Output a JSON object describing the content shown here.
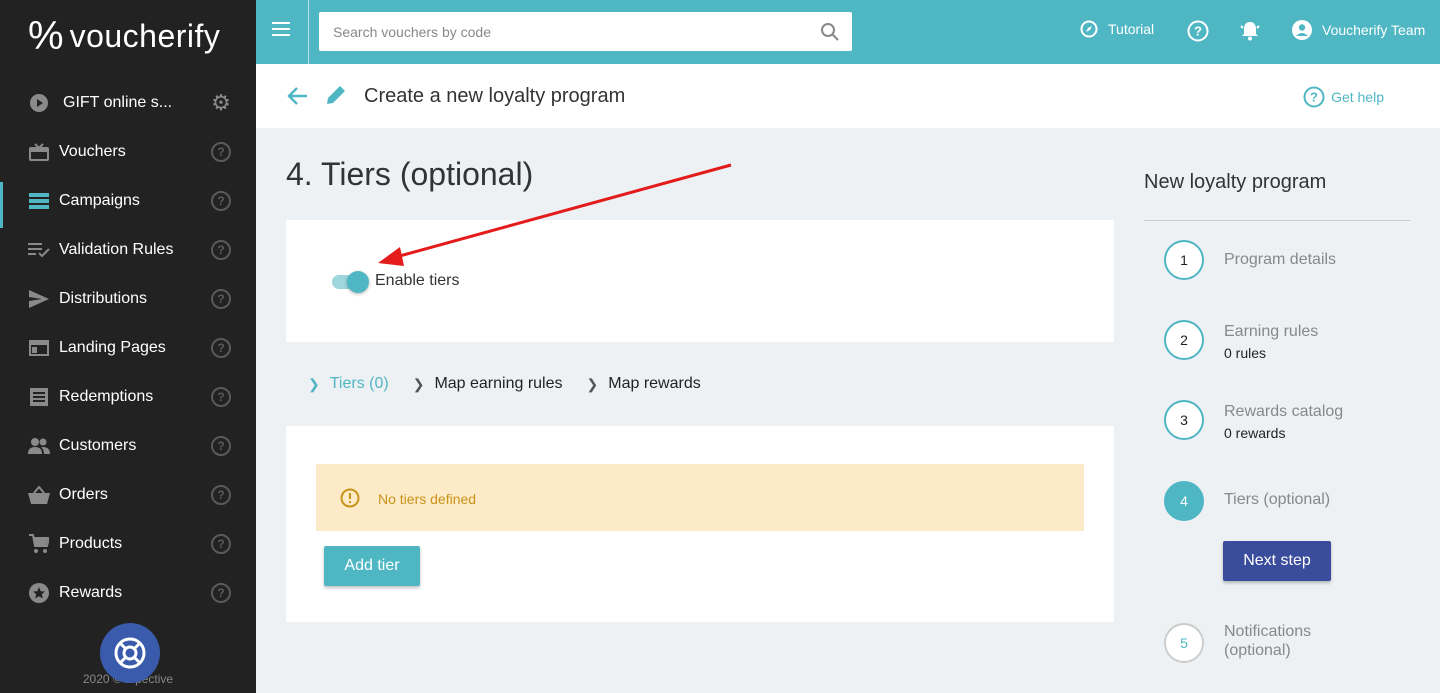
{
  "brand": {
    "logo_mark": "%",
    "logo_text": "voucherify"
  },
  "sidebar": {
    "project": "GIFT online s...",
    "items": [
      {
        "label": "Vouchers",
        "icon": "gift-icon"
      },
      {
        "label": "Campaigns",
        "icon": "campaigns-icon",
        "active": true
      },
      {
        "label": "Validation Rules",
        "icon": "validation-rules-icon"
      },
      {
        "label": "Distributions",
        "icon": "send-icon"
      },
      {
        "label": "Landing Pages",
        "icon": "landing-page-icon"
      },
      {
        "label": "Redemptions",
        "icon": "redemptions-icon"
      },
      {
        "label": "Customers",
        "icon": "customers-icon"
      },
      {
        "label": "Orders",
        "icon": "basket-icon"
      },
      {
        "label": "Products",
        "icon": "cart-icon"
      },
      {
        "label": "Rewards",
        "icon": "star-icon"
      }
    ],
    "help_glyph": "?",
    "copyright": "2020 © rspective"
  },
  "topbar": {
    "search_placeholder": "Search vouchers by code",
    "tutorial": "Tutorial",
    "user": "Voucherify Team"
  },
  "header": {
    "title": "Create a new loyalty program",
    "get_help": "Get help"
  },
  "main": {
    "section_title": "4. Tiers (optional)",
    "toggle_label": "Enable tiers",
    "toggle_on": true,
    "tabs": [
      {
        "label": "Tiers (0)",
        "active": true
      },
      {
        "label": "Map earning rules"
      },
      {
        "label": "Map rewards"
      }
    ],
    "alert_text": "No tiers defined",
    "add_button": "Add tier"
  },
  "right_panel": {
    "title": "New loyalty program",
    "steps": [
      {
        "num": "1",
        "label": "Program details",
        "sub": ""
      },
      {
        "num": "2",
        "label": "Earning rules",
        "sub": "0 rules"
      },
      {
        "num": "3",
        "label": "Rewards catalog",
        "sub": "0 rewards"
      },
      {
        "num": "4",
        "label": "Tiers (optional)",
        "sub": ""
      },
      {
        "num": "5",
        "label": "Notifications",
        "label2": "(optional)",
        "sub": ""
      }
    ],
    "next_button": "Next step"
  },
  "colors": {
    "accent": "#4fb7c4",
    "primary_button": "#3a4d9c",
    "sidebar_bg": "#222222",
    "alert_bg": "#fdebc8",
    "alert_text": "#c9931a",
    "annotation_arrow": "#e31b1b"
  }
}
